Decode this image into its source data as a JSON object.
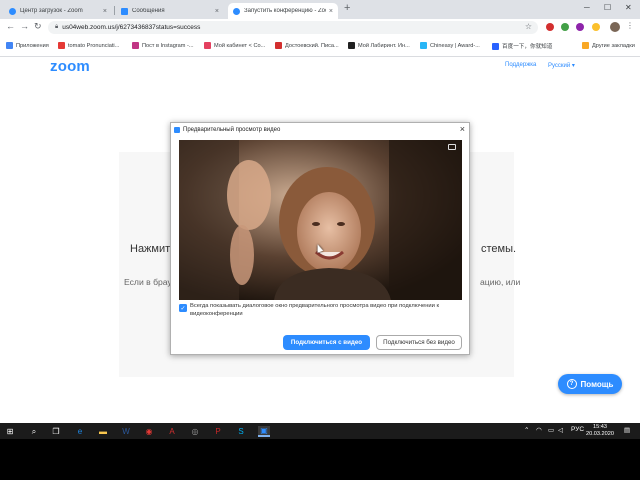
{
  "browser": {
    "tabs": [
      {
        "title": "Центр загрузок - Zoom",
        "active": false
      },
      {
        "title": "Сообщения",
        "active": false
      },
      {
        "title": "Запустить конференцию - Zoom",
        "active": true
      }
    ],
    "new_tab_label": "+",
    "address": "us04web.zoom.us/j/6273436837status=success",
    "bookmarks": [
      {
        "label": "Приложения",
        "color": "#4285f4"
      },
      {
        "label": "tomato Pronunciati...",
        "color": "#e53935"
      },
      {
        "label": "Пост в Instagram -...",
        "color": "#c13584"
      },
      {
        "label": "Мой кабинет < Co...",
        "color": "#e4405f"
      },
      {
        "label": "Достоевский. Писа...",
        "color": "#d32f2f"
      },
      {
        "label": "Мой Лабиринт. Ин...",
        "color": "#212121"
      },
      {
        "label": "Chineasy | Award-...",
        "color": "#29b6f6"
      },
      {
        "label": "百度一下，你就知道",
        "color": "#2962ff"
      },
      {
        "label": "Другие закладки",
        "color": "#f9a825"
      }
    ]
  },
  "page": {
    "logo": "zoom",
    "support_link": "Поддержка",
    "language_link": "Русский ▾",
    "text_line1_start": "Нажмит",
    "text_line1_end": "стемы.",
    "text_line2_start": "Если в брау",
    "text_line2_end": "ацию, или"
  },
  "dialog": {
    "title": "Предварительный просмотр видео",
    "checkbox_checked": true,
    "checkbox_label": "Всегда показывать диалоговое окно предварительного просмотра видео при подключении к видеоконференции",
    "join_with_video": "Подключиться с видео",
    "join_without_video": "Подключиться без видео"
  },
  "help_button": "Помощь",
  "taskbar": {
    "language": "РУС",
    "time": "15:43",
    "date": "20.03.2020"
  },
  "colors": {
    "accent": "#2d8cff"
  }
}
